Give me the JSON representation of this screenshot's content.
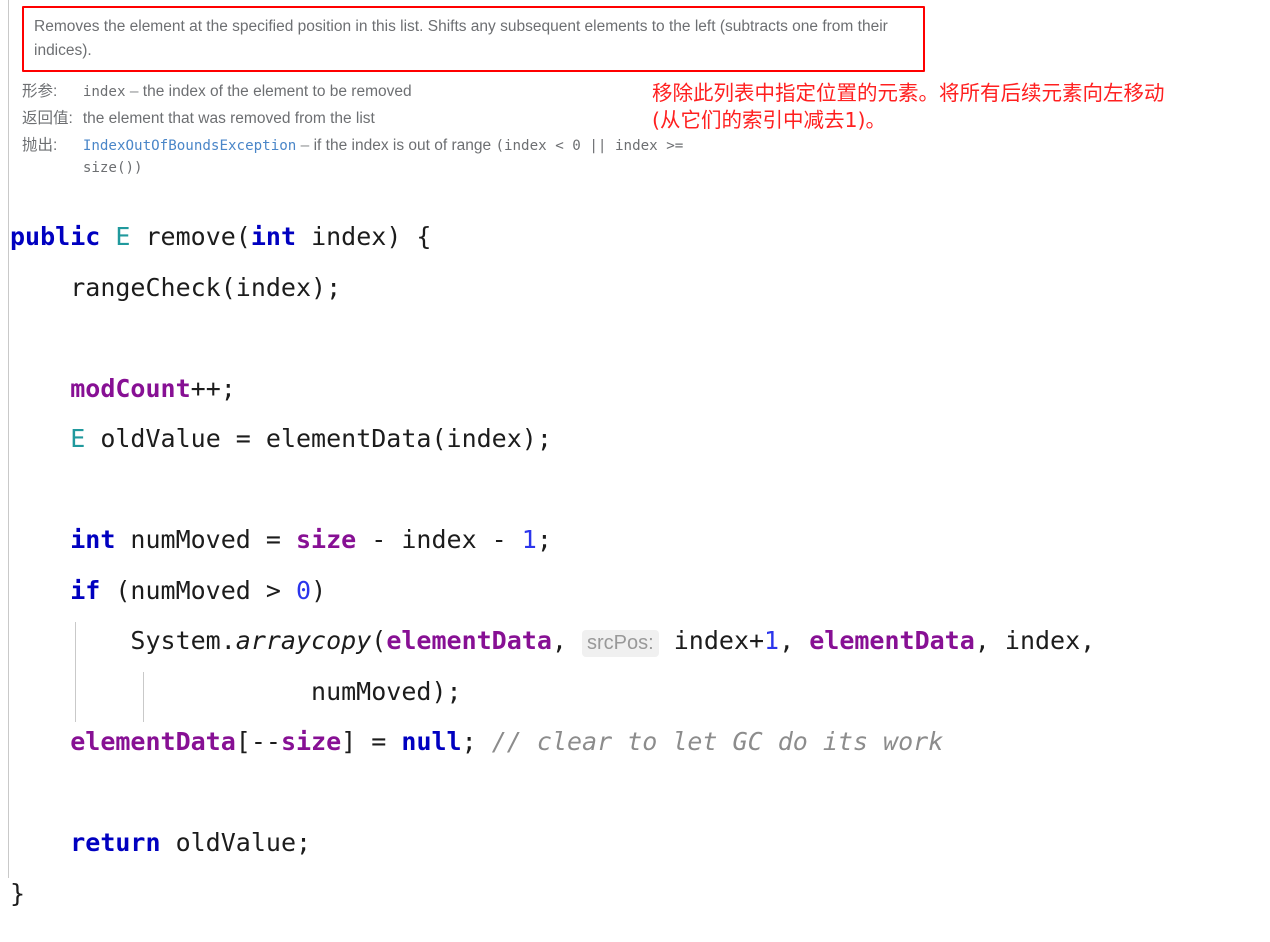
{
  "documentation": {
    "summary": "Removes the element at the specified position in this list. Shifts any subsequent elements to the left (subtracts one from their indices).",
    "rows": [
      {
        "label": "形参:",
        "term": "index",
        "dash": "–",
        "desc": "the index of the element to be removed"
      },
      {
        "label": "返回值:",
        "term": "",
        "dash": "",
        "desc": "the element that was removed from the list"
      },
      {
        "label": "抛出:",
        "term": "IndexOutOfBoundsException",
        "dash": "–",
        "desc": "if the index is out of range",
        "code_tail": "(index < 0 || index >=",
        "code_tail2": "size())"
      }
    ],
    "highlight_border_color": "#ff0000"
  },
  "annotation": {
    "text": "移除此列表中指定位置的元素。将所有后续元素向左移动\n(从它们的索引中减去1)。",
    "color": "#ff2020"
  },
  "code": {
    "language": "Java",
    "signature": {
      "modifier": "public",
      "return_type": "E",
      "name": " remove(",
      "param_type": "int",
      "param_name": " index) {"
    },
    "lines": {
      "range_check": "rangeCheck(index);",
      "mod_count_field": "modCount",
      "mod_count_rest": "++;",
      "old_value_type": "E",
      "old_value_rest": " oldValue = elementData(index);",
      "num_moved_kw": "int",
      "num_moved_a": " numMoved = ",
      "num_moved_field": "size",
      "num_moved_b": " - index - ",
      "num_moved_num": "1",
      "num_moved_c": ";",
      "if_kw": "if",
      "if_a": " (numMoved > ",
      "if_num": "0",
      "if_b": ")",
      "copy_a": "System.",
      "copy_static": "arraycopy",
      "copy_b": "(",
      "copy_field1": "elementData",
      "copy_c": ", ",
      "copy_hint": "srcPos:",
      "copy_d": " index+",
      "copy_num": "1",
      "copy_e": ", ",
      "copy_field2": "elementData",
      "copy_f": ", index,",
      "copy_cont": "numMoved);",
      "clear_field1": "elementData",
      "clear_a": "[--",
      "clear_field2": "size",
      "clear_b": "] = ",
      "clear_kw": "null",
      "clear_c": "; ",
      "clear_comment": "// clear to let GC do its work",
      "return_kw": "return",
      "return_rest": " oldValue;",
      "close_brace": "}"
    }
  },
  "theme": {
    "background": "#ffffff",
    "text": "#1c1c1c",
    "keyword": "#0000c0",
    "field": "#871094",
    "type": "#20999d",
    "number": "#2b35ec",
    "comment": "#8c8c8c",
    "doc_text": "#6d6f72",
    "link": "#4a86c8",
    "inlay_hint_bg": "#f0f0f0",
    "inlay_hint_text": "#999999",
    "indent_guide": "#c9c9c9"
  }
}
